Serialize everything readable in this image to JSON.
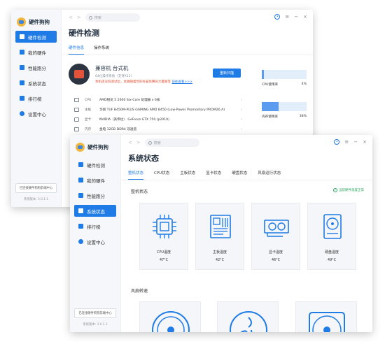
{
  "colors": {
    "accent": "#1f7be6",
    "warning": "#e44c2f",
    "ok": "#29a55a"
  },
  "window1": {
    "app_name": "硬件狗狗",
    "nav": [
      {
        "label": "硬件检测",
        "icon": "monitor-icon",
        "active": true
      },
      {
        "label": "我的硬件",
        "icon": "phone-icon",
        "active": false
      },
      {
        "label": "性能跑分",
        "icon": "chart-icon",
        "active": false
      },
      {
        "label": "系统状态",
        "icon": "status-icon",
        "active": false
      },
      {
        "label": "排行榜",
        "icon": "ranking-icon",
        "active": false
      },
      {
        "label": "设置中心",
        "icon": "settings-icon",
        "active": false
      }
    ],
    "footer_button": "已连接硬件狗狗前端中心",
    "version": "系统版本: 3.0.1.1",
    "search_placeholder": "搜索",
    "title": "硬件检测",
    "tabs": [
      {
        "label": "硬件信息",
        "active": true
      },
      {
        "label": "操作系统",
        "active": false
      }
    ],
    "pc_name": "兼容机 台式机",
    "pc_os": "64位操作系统（支持X12）",
    "pc_warning": "本机还没有测试位，本随随着你的有安装腾讯大赢家等 ",
    "pc_warning_link": "前往查看>>>",
    "rescan_label": "重新扫描",
    "hardware": [
      {
        "key": "CPU",
        "value": "AMD锐龙 5 2600 Six-Core 处理器 x 6核"
      },
      {
        "key": "主板",
        "value": "华硕 TUF B450M-PLUS GAMING AMD B450 (Low-Power Promontory PROM26.A)"
      },
      {
        "key": "显卡",
        "value": "NVIDIA（英伟达）  GeForce GTX 750 (p2010)"
      },
      {
        "key": "内存",
        "value": "金电 32GB DDR4 双通道"
      }
    ],
    "usage": [
      {
        "label": "CPU使用率",
        "value": "4%",
        "fraction": 0.04
      },
      {
        "label": "内存使用率",
        "value": "38%",
        "fraction": 0.38
      }
    ]
  },
  "window2": {
    "app_name": "硬件狗狗",
    "nav": [
      {
        "label": "硬件检测",
        "icon": "monitor-icon",
        "active": false
      },
      {
        "label": "我的硬件",
        "icon": "phone-icon",
        "active": false
      },
      {
        "label": "性能跑分",
        "icon": "chart-icon",
        "active": false
      },
      {
        "label": "系统状态",
        "icon": "status-icon",
        "active": true
      },
      {
        "label": "排行榜",
        "icon": "ranking-icon",
        "active": false
      },
      {
        "label": "设置中心",
        "icon": "settings-icon",
        "active": false
      }
    ],
    "footer_button": "已连接硬件狗狗前端中心",
    "version": "系统版本: 3.0.1.1",
    "search_placeholder": "搜索",
    "title": "系统状态",
    "tabs": [
      {
        "label": "整机状态",
        "active": true
      },
      {
        "label": "CPU状态",
        "active": false
      },
      {
        "label": "主板状态",
        "active": false
      },
      {
        "label": "显卡状态",
        "active": false
      },
      {
        "label": "硬盘状态",
        "active": false
      },
      {
        "label": "风扇运行状态",
        "active": false
      }
    ],
    "section_machine": "整机状态",
    "status_text": "当前硬件温度正常",
    "temps": [
      {
        "label": "CPU温度",
        "value": "47°C",
        "icon": "cpu-icon"
      },
      {
        "label": "主板温度",
        "value": "42°C",
        "icon": "motherboard-icon"
      },
      {
        "label": "显卡温度",
        "value": "46°C",
        "icon": "gpu-icon"
      },
      {
        "label": "硬盘温度",
        "value": "49°C",
        "icon": "harddisk-icon"
      }
    ],
    "section_fan": "风扇转速"
  }
}
